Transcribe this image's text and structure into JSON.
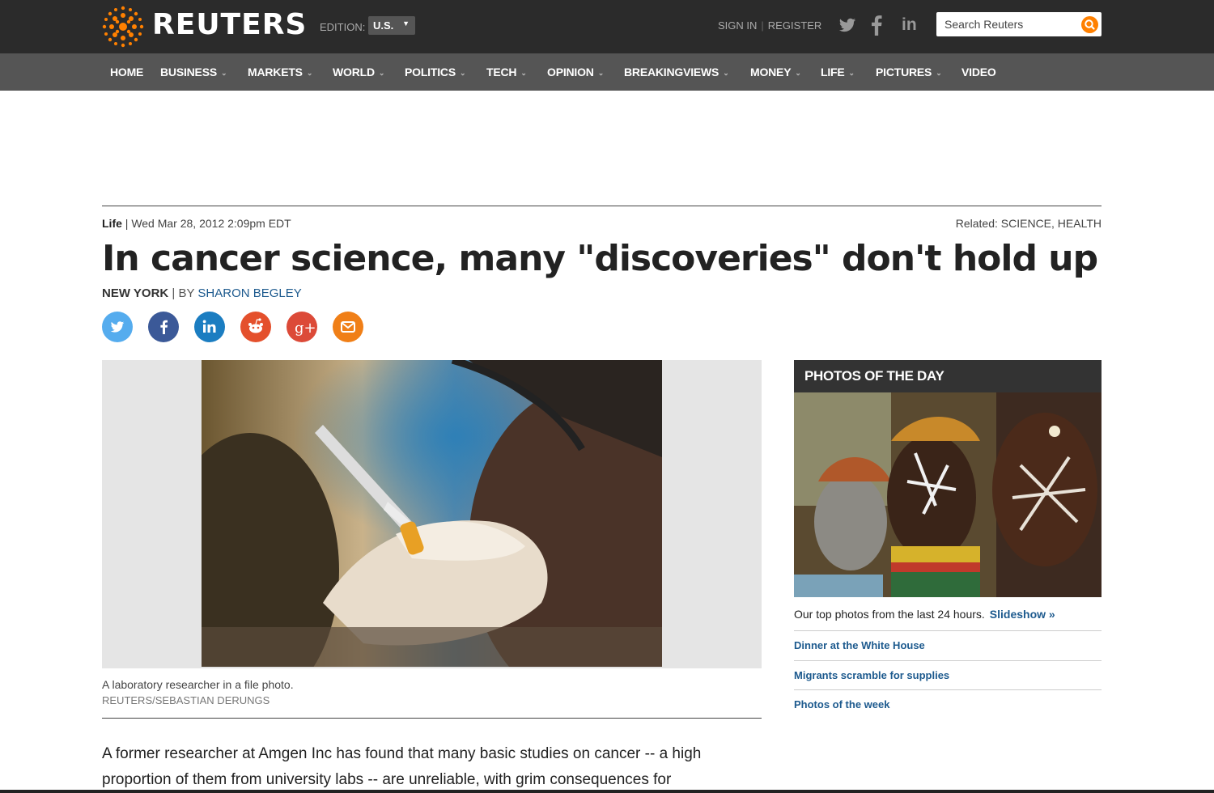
{
  "header": {
    "brand": "REUTERS",
    "edition_label": "EDITION:",
    "edition_value": "U.S.",
    "sign_in": "SIGN IN",
    "register": "REGISTER",
    "search_placeholder": "Search Reuters"
  },
  "nav": {
    "home": "HOME",
    "business": "BUSINESS",
    "markets": "MARKETS",
    "world": "WORLD",
    "politics": "POLITICS",
    "tech": "TECH",
    "opinion": "OPINION",
    "breakingviews": "BREAKINGVIEWS",
    "money": "MONEY",
    "life": "LIFE",
    "pictures": "PICTURES",
    "video": "VIDEO"
  },
  "article": {
    "section": "Life",
    "date": "Wed Mar 28, 2012 2:09pm EDT",
    "related_label": "Related:",
    "related_topics": "SCIENCE, HEALTH",
    "headline": "In cancer science, many \"discoveries\" don't hold up",
    "location": "NEW YORK",
    "by": "| BY",
    "author": "SHARON BEGLEY",
    "caption": "A laboratory researcher in a file photo.",
    "credit": "REUTERS/SEBASTIAN DERUNGS",
    "body_line1": "A former researcher at Amgen Inc has found that many basic studies on cancer -- a high",
    "body_line2": "proportion of them from university labs -- are unreliable, with grim consequences for"
  },
  "sidebar": {
    "title": "PHOTOS OF THE DAY",
    "description": "Our top photos from the last 24 hours.",
    "slideshow": "Slideshow »",
    "links": [
      "Dinner at the White House",
      "Migrants scramble for supplies",
      "Photos of the week"
    ]
  },
  "colors": {
    "accent_orange": "#ff8000",
    "link_blue": "#1d5a8e",
    "twitter": "#55acee",
    "facebook": "#3b5998",
    "linkedin": "#1b7dc1",
    "reddit": "#e4502c",
    "google_plus": "#dc4a38",
    "email": "#f07f17"
  }
}
